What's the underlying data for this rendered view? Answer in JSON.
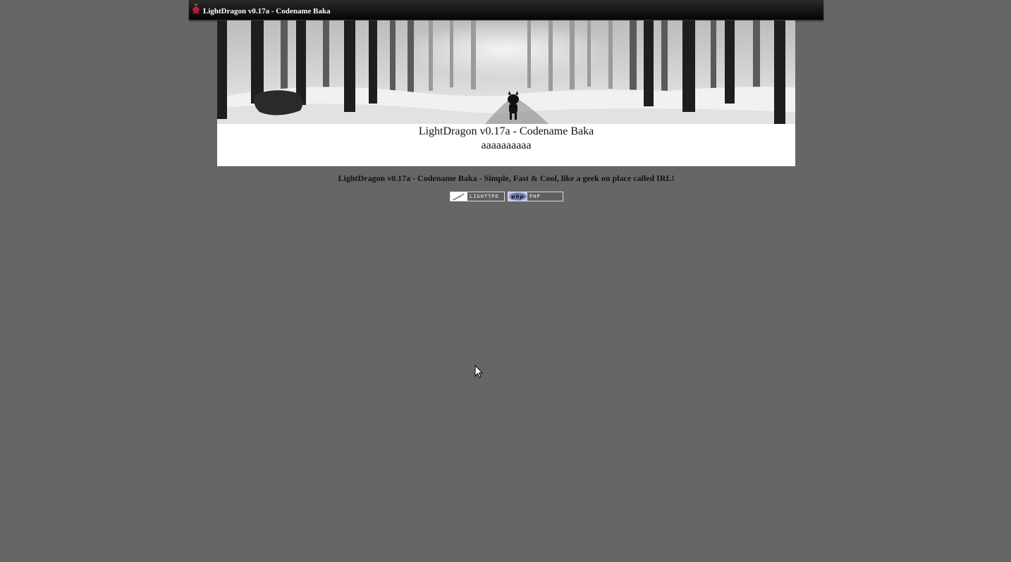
{
  "header": {
    "title": "LightDragon v0.17a - Codename Baka",
    "logo_icon": "raspberry-pi-icon"
  },
  "main": {
    "heading": "LightDragon v0.17a - Codename Baka",
    "subheading": "aaaaaaaaaa"
  },
  "footer": {
    "text": "LightDragon v0.17a - Codename Baka - Simple, Fast & Cool, like a geek on place called IRL!",
    "badges": [
      {
        "label": "LIGHTTPD",
        "icon": "feather-icon"
      },
      {
        "label": "PHP",
        "icon": "php-logo-icon"
      }
    ]
  },
  "colors": {
    "page_background": "#666666",
    "panel_background": "#ffffff",
    "topbar_background": "#0a0a0a"
  }
}
